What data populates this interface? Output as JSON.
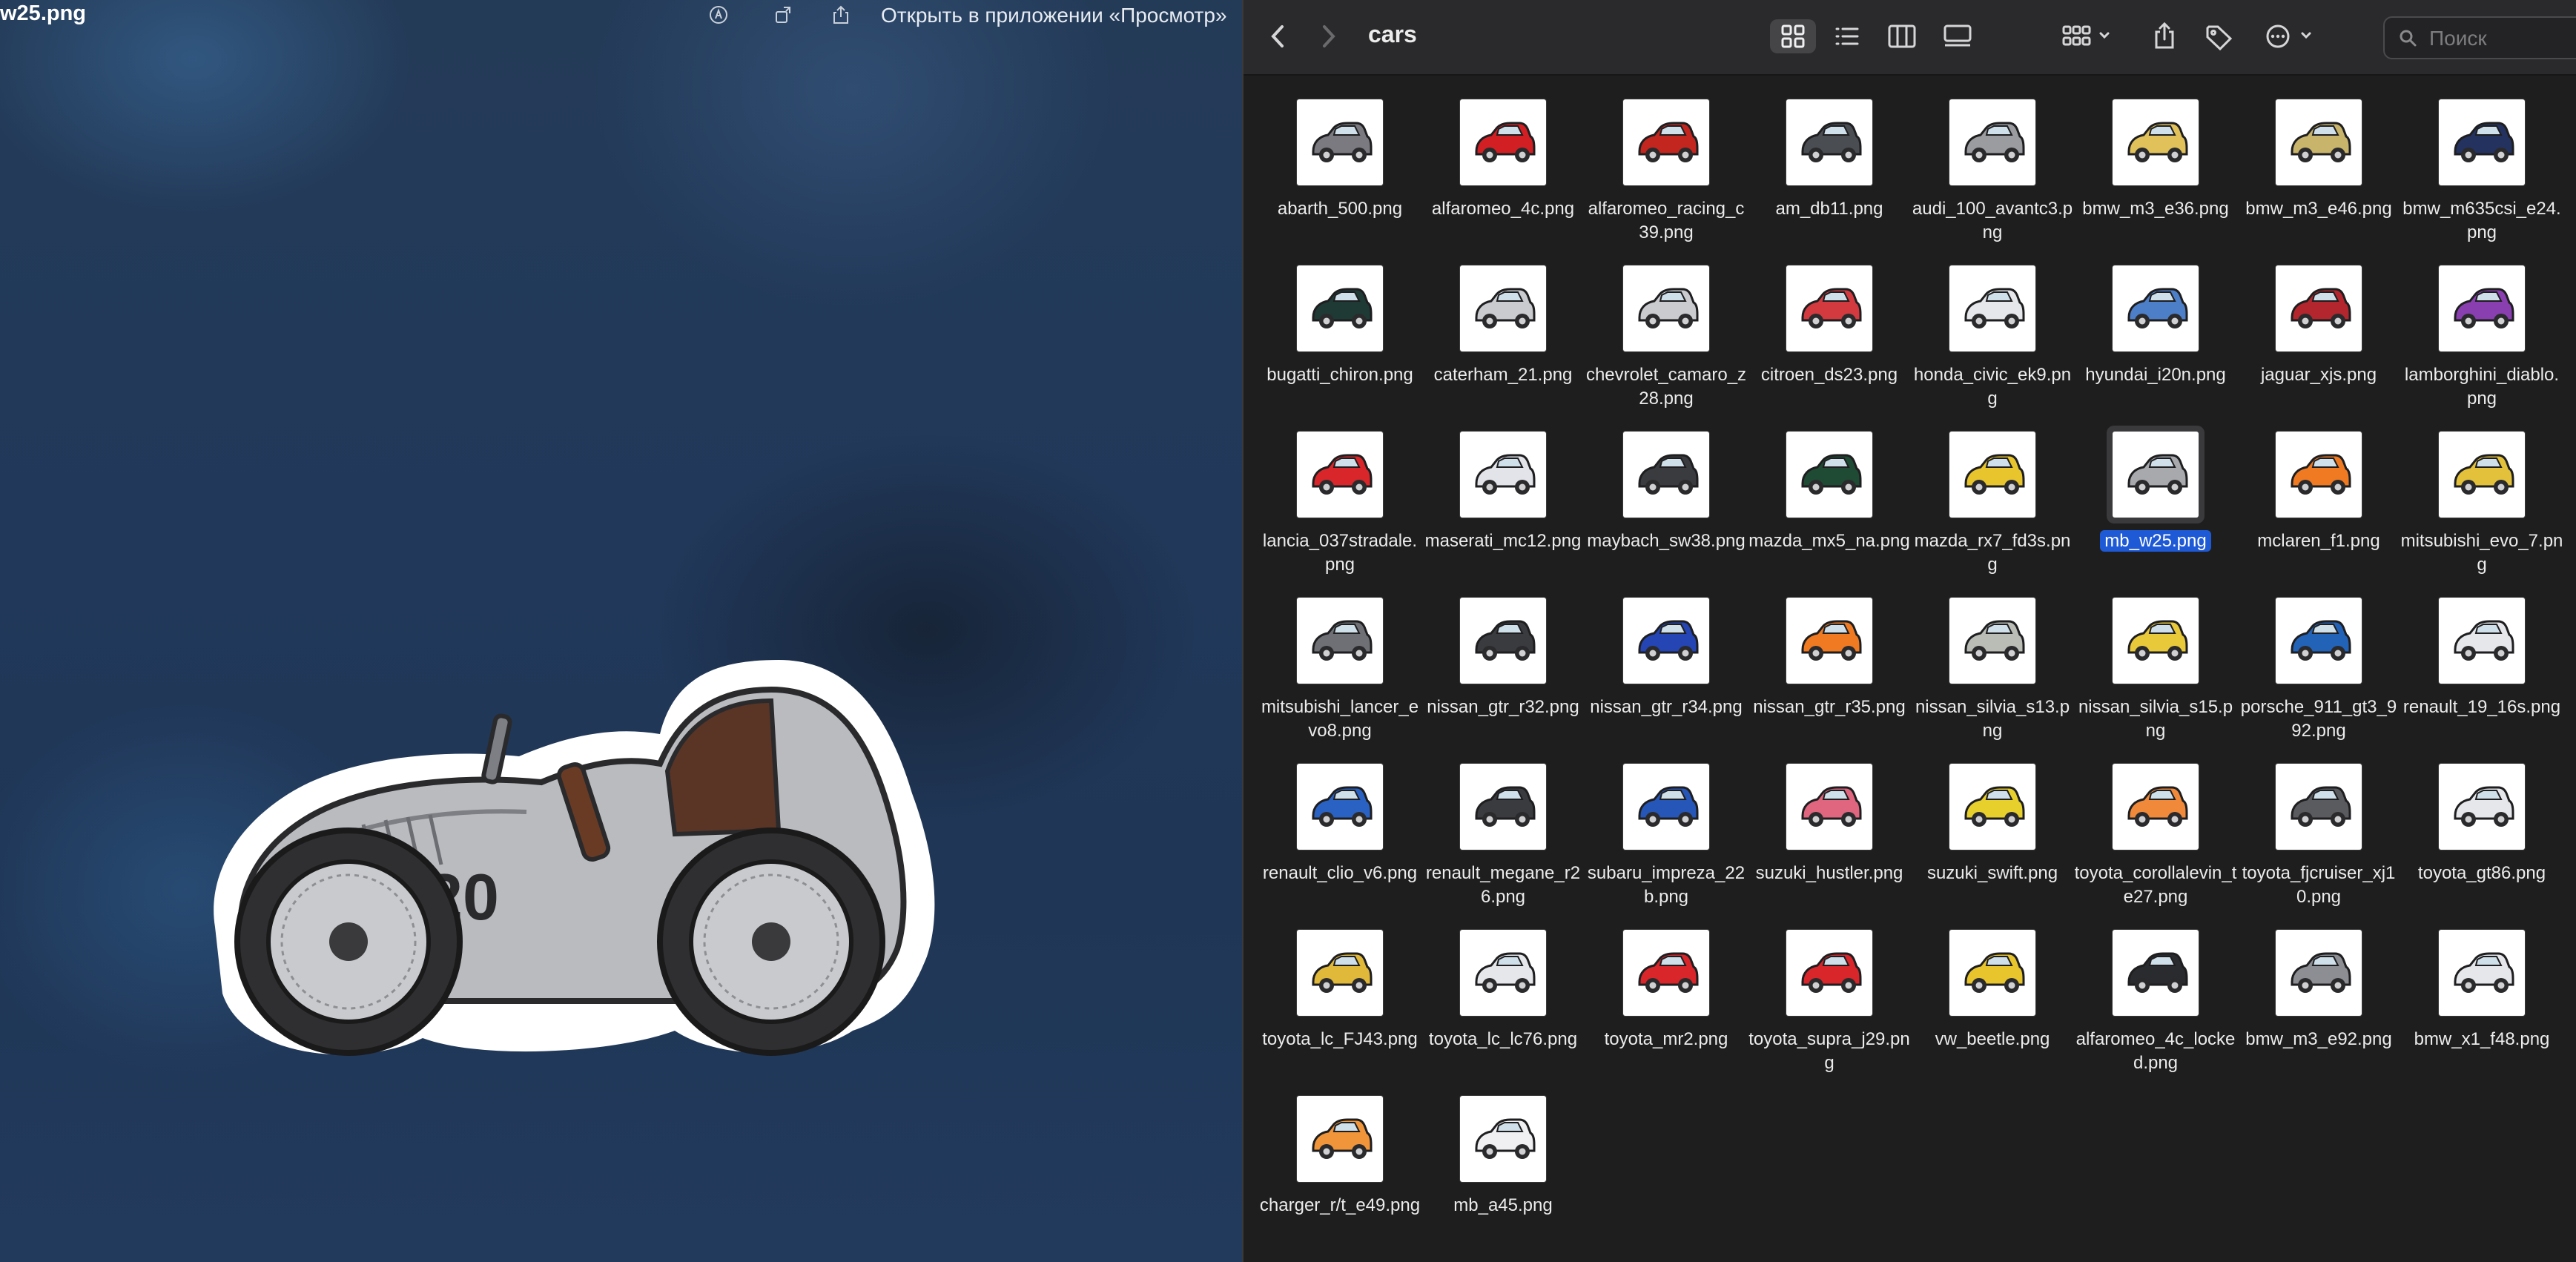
{
  "preview": {
    "title": "w25.png",
    "open_button": "Открыть в приложении «Просмотр»",
    "icons": [
      "markup-icon",
      "rotate-icon",
      "share-icon"
    ],
    "car_number": "20"
  },
  "finder": {
    "folder_title": "cars",
    "search_placeholder": "Поиск",
    "active_view": "icons",
    "selected_file": "mb_w25.png",
    "files": [
      {
        "name": "abarth_500.png",
        "color": "#7a7a80"
      },
      {
        "name": "alfaromeo_4c.png",
        "color": "#d21f24"
      },
      {
        "name": "alfaromeo_racing_c39.png",
        "color": "#c2261e"
      },
      {
        "name": "am_db11.png",
        "color": "#4a4d52"
      },
      {
        "name": "audi_100_avantc3.png",
        "color": "#9a9ca0"
      },
      {
        "name": "bmw_m3_e36.png",
        "color": "#e0c15a"
      },
      {
        "name": "bmw_m3_e46.png",
        "color": "#c8b46a"
      },
      {
        "name": "bmw_m635csi_e24.png",
        "color": "#24325f"
      },
      {
        "name": "bugatti_chiron.png",
        "color": "#1f3a35"
      },
      {
        "name": "caterham_21.png",
        "color": "#c9cbcf"
      },
      {
        "name": "chevrolet_camaro_z28.png",
        "color": "#c9cbcf"
      },
      {
        "name": "citroen_ds23.png",
        "color": "#d23a3f"
      },
      {
        "name": "honda_civic_ek9.png",
        "color": "#e6e7ea"
      },
      {
        "name": "hyundai_i20n.png",
        "color": "#4d7fc9"
      },
      {
        "name": "jaguar_xjs.png",
        "color": "#b3262d"
      },
      {
        "name": "lamborghini_diablo.png",
        "color": "#8a3fb0"
      },
      {
        "name": "lancia_037stradale.png",
        "color": "#d8262a"
      },
      {
        "name": "maserati_mc12.png",
        "color": "#e2e4ea"
      },
      {
        "name": "maybach_sw38.png",
        "color": "#3a3b3e"
      },
      {
        "name": "mazda_mx5_na.png",
        "color": "#1f4a33"
      },
      {
        "name": "mazda_rx7_fd3s.png",
        "color": "#e8c52c"
      },
      {
        "name": "mb_w25.png",
        "color": "#a7a9ad"
      },
      {
        "name": "mclaren_f1.png",
        "color": "#f07a22"
      },
      {
        "name": "mitsubishi_evo_7.png",
        "color": "#e3c13a"
      },
      {
        "name": "mitsubishi_lancer_evo8.png",
        "color": "#6e7075"
      },
      {
        "name": "nissan_gtr_r32.png",
        "color": "#3a3b3e"
      },
      {
        "name": "nissan_gtr_r34.png",
        "color": "#2445b3"
      },
      {
        "name": "nissan_gtr_r35.png",
        "color": "#f07a22"
      },
      {
        "name": "nissan_silvia_s13.png",
        "color": "#b9bdb6"
      },
      {
        "name": "nissan_silvia_s15.png",
        "color": "#e8c93a"
      },
      {
        "name": "porsche_911_gt3_992.png",
        "color": "#2263b8"
      },
      {
        "name": "renault_19_16s.png",
        "color": "#e6e7ea"
      },
      {
        "name": "renault_clio_v6.png",
        "color": "#2a62c4"
      },
      {
        "name": "renault_megane_r26.png",
        "color": "#3a3b3e"
      },
      {
        "name": "subaru_impreza_22b.png",
        "color": "#2656b8"
      },
      {
        "name": "suzuki_hustler.png",
        "color": "#e0657f"
      },
      {
        "name": "suzuki_swift.png",
        "color": "#e8d02c"
      },
      {
        "name": "toyota_corollalevin_te27.png",
        "color": "#f08a3a"
      },
      {
        "name": "toyota_fjcruiser_xj10.png",
        "color": "#5a5b5e"
      },
      {
        "name": "toyota_gt86.png",
        "color": "#e6e7ea"
      },
      {
        "name": "toyota_lc_FJ43.png",
        "color": "#e0b93a"
      },
      {
        "name": "toyota_lc_lc76.png",
        "color": "#e6e7ea"
      },
      {
        "name": "toyota_mr2.png",
        "color": "#d8262a"
      },
      {
        "name": "toyota_supra_j29.png",
        "color": "#d8262a"
      },
      {
        "name": "vw_beetle.png",
        "color": "#e8c52c"
      },
      {
        "name": "alfaromeo_4c_locked.png",
        "color": "#2a2b2e"
      },
      {
        "name": "bmw_m3_e92.png",
        "color": "#8c8e93"
      },
      {
        "name": "bmw_x1_f48.png",
        "color": "#e6e7ea"
      },
      {
        "name": "charger_r/t_e49.png",
        "color": "#f0953a"
      },
      {
        "name": "mb_a45.png",
        "color": "#f0f0f2"
      }
    ]
  }
}
